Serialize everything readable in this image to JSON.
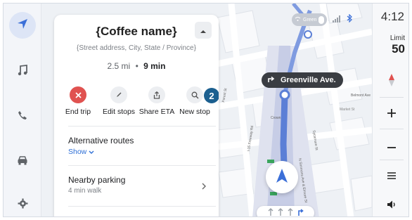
{
  "status": {
    "time": "4:12",
    "pill_label": "Green",
    "wifi_icon": "wifi-icon",
    "signal_icon": "signal-icon",
    "bluetooth_icon": "bluetooth-icon"
  },
  "speed_limit": {
    "label": "Limit",
    "value": "50"
  },
  "rail": {
    "items": [
      "navigation-icon",
      "music-icon",
      "phone-icon",
      "car-icon",
      "settings-icon"
    ],
    "active": "navigation-icon"
  },
  "panel": {
    "title": "{Coffee name}",
    "address": "{Street address, City, State / Province}",
    "distance": "2.5 mi",
    "separator": "•",
    "duration": "9 min",
    "actions": [
      {
        "label": "End trip",
        "icon": "close-icon"
      },
      {
        "label": "Edit stops",
        "icon": "pencil-icon"
      },
      {
        "label": "Share ETA",
        "icon": "share-icon"
      },
      {
        "label": "New stop",
        "icon": "search-icon"
      }
    ],
    "badge": "2",
    "alternative_routes": {
      "title": "Alternative routes",
      "link": "Show"
    },
    "nearby_parking": {
      "title": "Nearby parking",
      "subtitle": "4 min walk"
    }
  },
  "map": {
    "next_street": "Greenville Ave.",
    "street_labels": [
      "Crown",
      "I-35 Freeway Rd",
      "N Simmons Ave & Elmore St",
      "Sycamore St",
      "Forest St",
      "Belmont Ave",
      "Market St"
    ]
  },
  "controls": [
    "compass-icon",
    "zoom-in-icon",
    "zoom-out-icon",
    "menu-icon",
    "volume-icon"
  ],
  "colors": {
    "accent": "#3b6fd8",
    "route": "#5b7fd6",
    "end_trip": "#e05250",
    "badge": "#1b5f8f",
    "street_tag": "#3a3d42"
  }
}
